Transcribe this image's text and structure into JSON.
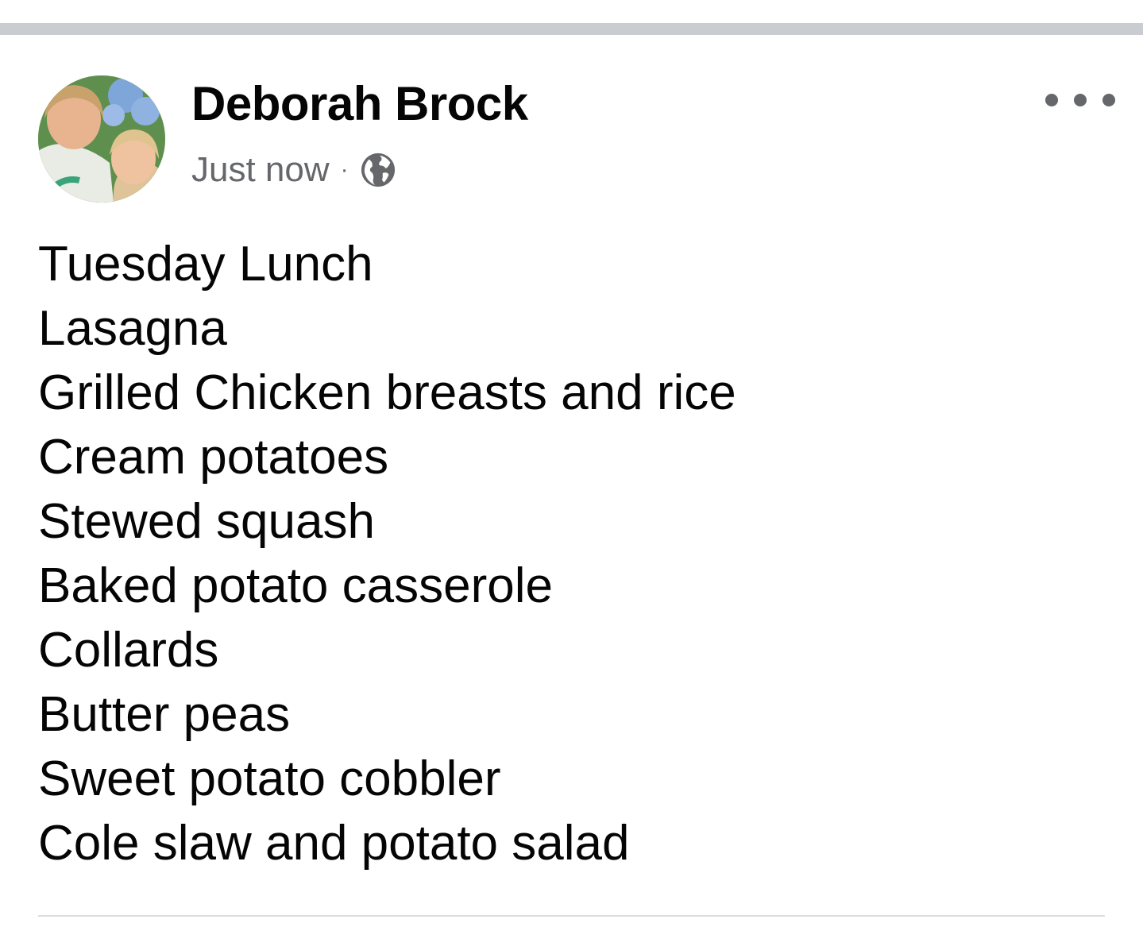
{
  "post": {
    "author_name": "Deborah Brock",
    "timestamp": "Just now",
    "separator": "·",
    "audience_icon": "globe-icon",
    "more_icon": "more-horizontal-icon",
    "lines": [
      "Tuesday Lunch",
      "Lasagna",
      "Grilled Chicken breasts and rice",
      "Cream potatoes",
      "Stewed squash",
      "Baked potato casserole",
      "Collards",
      "Butter peas",
      "Sweet potato cobbler",
      "Cole slaw and potato salad"
    ]
  },
  "colors": {
    "text_primary": "#050505",
    "text_secondary": "#65676b",
    "divider": "#c9ccd1",
    "background": "#ffffff"
  }
}
